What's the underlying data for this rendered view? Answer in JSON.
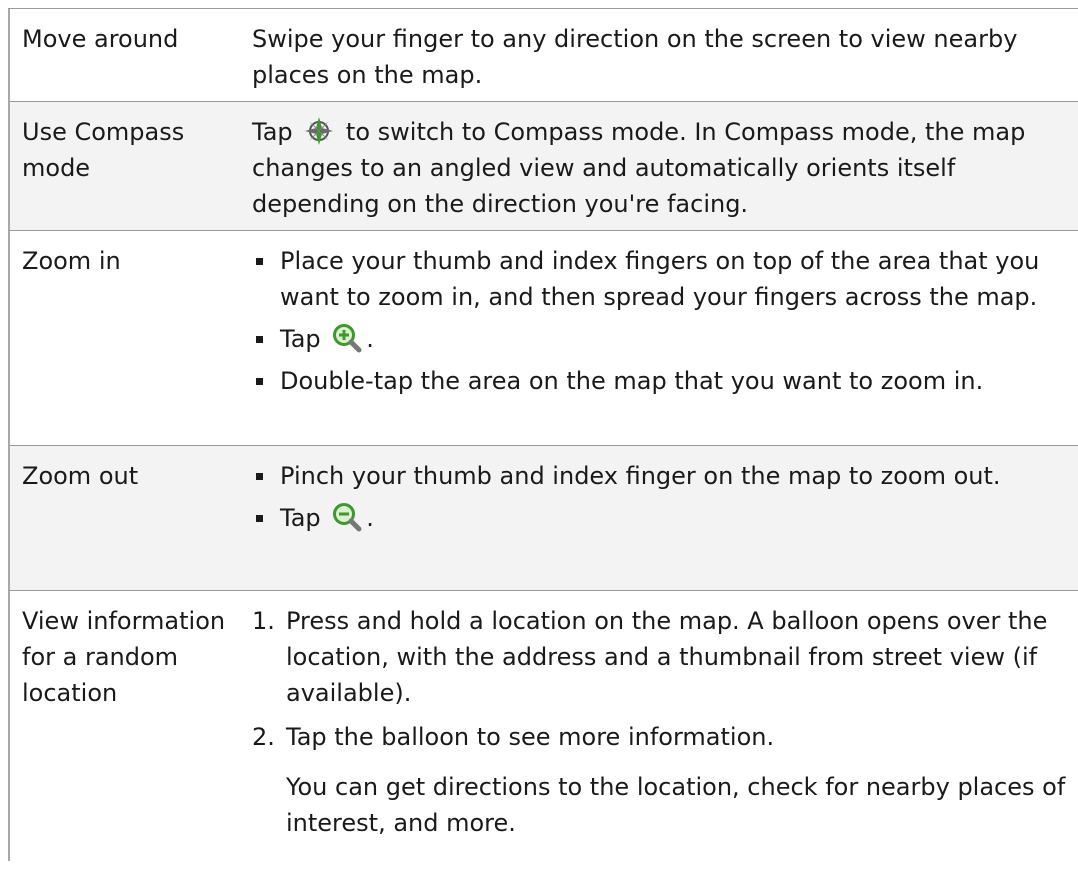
{
  "rows": [
    {
      "label": "Move around",
      "text": "Swipe your finger to any direction on the screen to view nearby places on the map."
    },
    {
      "label": "Use Compass mode",
      "text_before": "Tap",
      "icon": "compass-icon",
      "text_after": "to switch to Compass mode. In Compass mode, the map changes to an angled view and automatically orients itself depending on the direction you're facing."
    },
    {
      "label": "Zoom in",
      "bullets": [
        {
          "text": "Place your thumb and index fingers on top of the area that you want to zoom in, and then spread your fingers across the map."
        },
        {
          "text_before": "Tap",
          "icon": "zoom-in-icon",
          "text_after": "."
        },
        {
          "text": "Double-tap the area on the map that you want to zoom in."
        }
      ]
    },
    {
      "label": "Zoom out",
      "bullets": [
        {
          "text": "Pinch your thumb and index finger on the map to zoom out."
        },
        {
          "text_before": "Tap",
          "icon": "zoom-out-icon",
          "text_after": "."
        }
      ]
    },
    {
      "label": "View information for a random location",
      "steps": [
        {
          "num": "1.",
          "text": "Press and hold a location on the map. A balloon opens over the location, with the address and a thumbnail from street view (if available)."
        },
        {
          "num": "2.",
          "text": "Tap the balloon to see more information."
        }
      ],
      "note": "You can get directions to the location, check for nearby places of interest, and more."
    }
  ],
  "colors": {
    "text": "#1a1a1a",
    "rule": "#9a9a9a",
    "row_tint": "#f3f3f3",
    "icon_green": "#3a9a2a"
  }
}
